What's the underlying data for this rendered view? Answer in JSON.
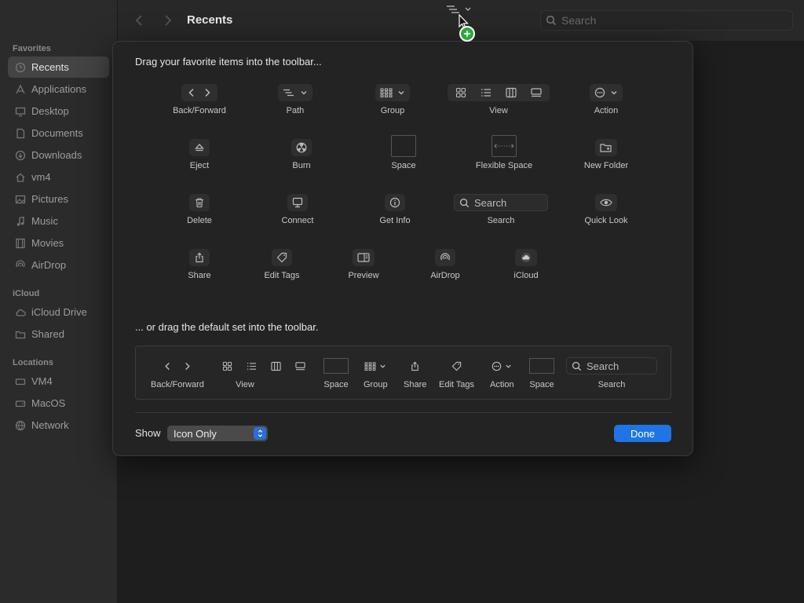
{
  "window": {
    "title": "Recents"
  },
  "toolbar": {
    "search_placeholder": "Search"
  },
  "sidebar": {
    "sections": [
      {
        "title": "Favorites",
        "items": [
          {
            "label": "Recents",
            "icon": "clock-icon",
            "active": true
          },
          {
            "label": "Applications",
            "icon": "apps-icon"
          },
          {
            "label": "Desktop",
            "icon": "desktop-icon"
          },
          {
            "label": "Documents",
            "icon": "document-icon"
          },
          {
            "label": "Downloads",
            "icon": "download-icon"
          },
          {
            "label": "vm4",
            "icon": "home-icon"
          },
          {
            "label": "Pictures",
            "icon": "photo-icon"
          },
          {
            "label": "Music",
            "icon": "music-icon"
          },
          {
            "label": "Movies",
            "icon": "film-icon"
          },
          {
            "label": "AirDrop",
            "icon": "airdrop-icon"
          }
        ]
      },
      {
        "title": "iCloud",
        "items": [
          {
            "label": "iCloud Drive",
            "icon": "cloud-icon"
          },
          {
            "label": "Shared",
            "icon": "folder-shared-icon"
          }
        ]
      },
      {
        "title": "Locations",
        "items": [
          {
            "label": "VM4",
            "icon": "computer-icon"
          },
          {
            "label": "MacOS",
            "icon": "disk-icon"
          },
          {
            "label": "Network",
            "icon": "globe-icon"
          }
        ]
      }
    ]
  },
  "customize": {
    "heading": "Drag your favorite items into the toolbar...",
    "items": [
      {
        "label": "Back/Forward",
        "icon": "back-forward-icon"
      },
      {
        "label": "Path",
        "icon": "path-icon"
      },
      {
        "label": "Group",
        "icon": "group-icon"
      },
      {
        "label": "View",
        "icon": "view-icon"
      },
      {
        "label": "Action",
        "icon": "action-icon"
      },
      {
        "label": "Eject",
        "icon": "eject-icon"
      },
      {
        "label": "Burn",
        "icon": "burn-icon"
      },
      {
        "label": "Space",
        "icon": "space-icon"
      },
      {
        "label": "Flexible Space",
        "icon": "flexible-space-icon"
      },
      {
        "label": "New Folder",
        "icon": "new-folder-icon"
      },
      {
        "label": "Delete",
        "icon": "trash-icon"
      },
      {
        "label": "Connect",
        "icon": "connect-icon"
      },
      {
        "label": "Get Info",
        "icon": "info-icon"
      },
      {
        "label": "Search",
        "icon": "search-icon",
        "field_text": "Search"
      },
      {
        "label": "Quick Look",
        "icon": "eye-icon"
      },
      {
        "label": "Share",
        "icon": "share-icon"
      },
      {
        "label": "Edit Tags",
        "icon": "tag-icon"
      },
      {
        "label": "Preview",
        "icon": "preview-icon"
      },
      {
        "label": "AirDrop",
        "icon": "airdrop-icon"
      },
      {
        "label": "iCloud",
        "icon": "icloud-icon"
      }
    ],
    "default_heading": "... or drag the default set into the toolbar.",
    "default_set": [
      {
        "label": "Back/Forward"
      },
      {
        "label": "View"
      },
      {
        "label": "Space"
      },
      {
        "label": "Group"
      },
      {
        "label": "Share"
      },
      {
        "label": "Edit Tags"
      },
      {
        "label": "Action"
      },
      {
        "label": "Space"
      },
      {
        "label": "Search",
        "field_text": "Search"
      }
    ],
    "show_label": "Show",
    "show_value": "Icon Only",
    "done_label": "Done"
  },
  "colors": {
    "accent": "#1f74e6",
    "drag_badge": "#2fa83b"
  }
}
